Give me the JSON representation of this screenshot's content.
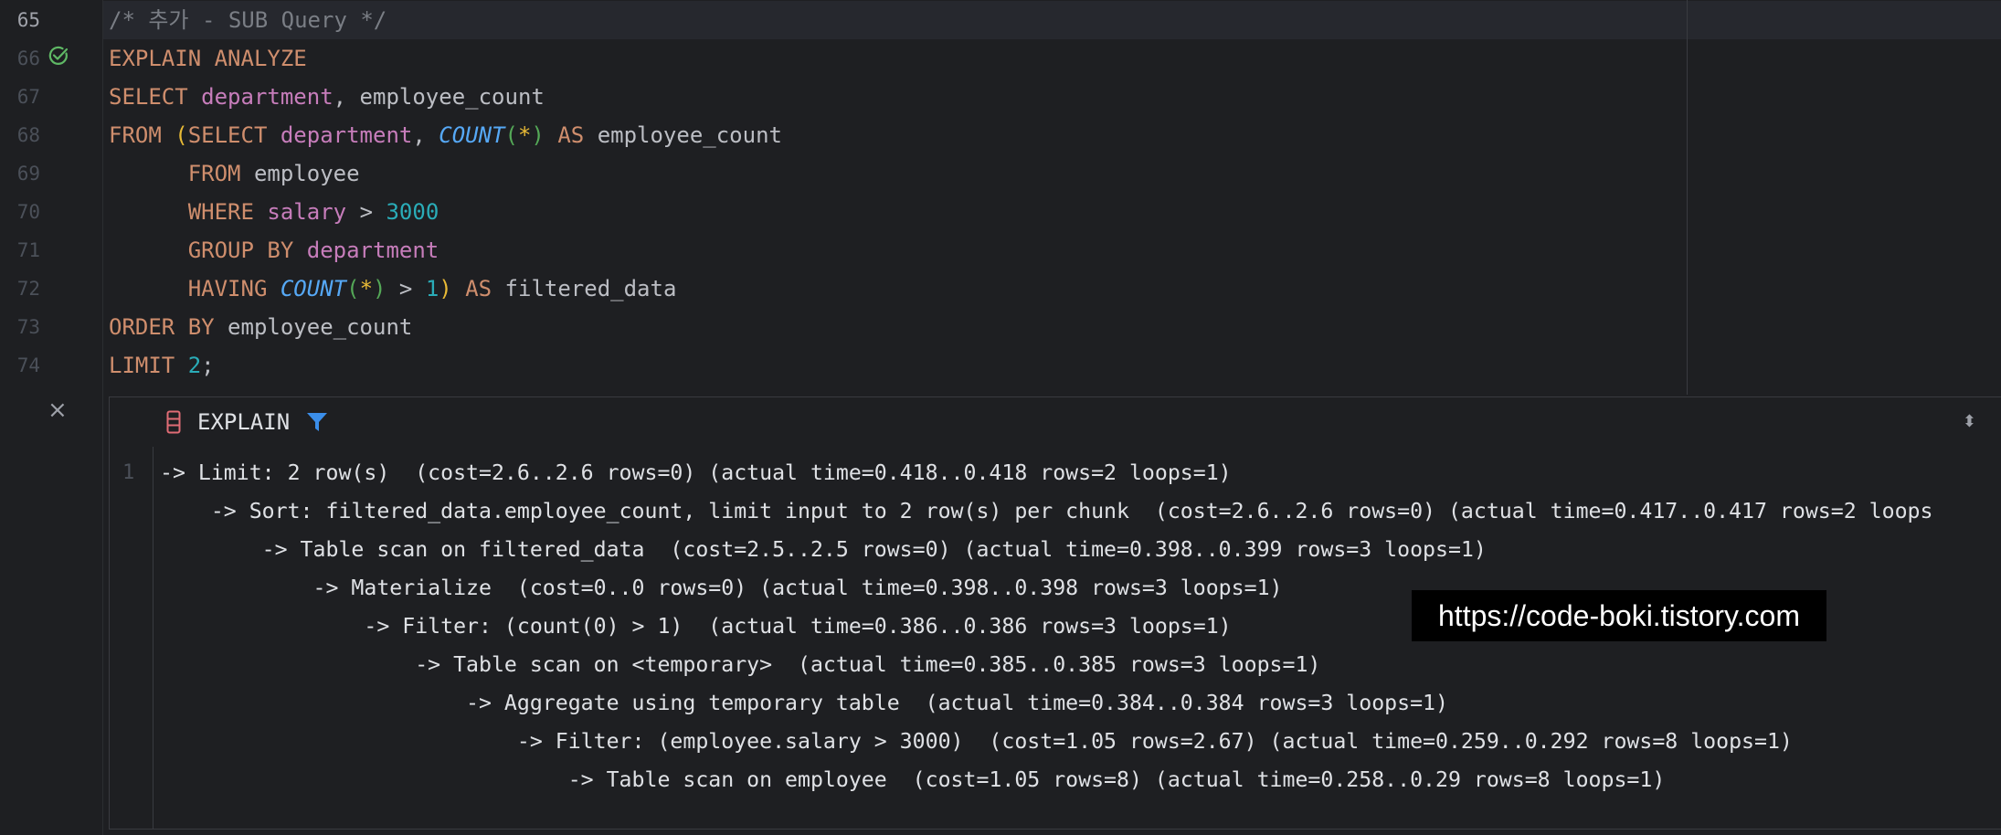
{
  "editor": {
    "lines": [
      {
        "num": "65",
        "current": true
      },
      {
        "num": "66"
      },
      {
        "num": "67"
      },
      {
        "num": "68"
      },
      {
        "num": "69"
      },
      {
        "num": "70"
      },
      {
        "num": "71"
      },
      {
        "num": "72"
      },
      {
        "num": "73"
      },
      {
        "num": "74"
      }
    ],
    "code": {
      "l65": "/* 추가 - SUB Query */",
      "l66_kw": "EXPLAIN ANALYZE",
      "l67_kw": "SELECT",
      "l67_fld": "department",
      "l67_rest": ", employee_count",
      "l68_kw": "FROM",
      "l68_p": "(",
      "l68_kw2": "SELECT",
      "l68_fld": "department",
      "l68_comma": ",",
      "l68_fn": "COUNT",
      "l68_po": "(",
      "l68_star": "*",
      "l68_pc": ")",
      "l68_as": "AS",
      "l68_alias": "employee_count",
      "l69_kw": "FROM",
      "l69_tbl": "employee",
      "l70_kw": "WHERE",
      "l70_fld": "salary",
      "l70_op": ">",
      "l70_num": "3000",
      "l71_kw": "GROUP BY",
      "l71_fld": "department",
      "l72_kw": "HAVING",
      "l72_fn": "COUNT",
      "l72_po": "(",
      "l72_star": "*",
      "l72_pc": ")",
      "l72_op": ">",
      "l72_num": "1",
      "l72_p": ")",
      "l72_as": "AS",
      "l72_alias": "filtered_data",
      "l73_kw": "ORDER BY",
      "l73_rest": "employee_count",
      "l74_kw": "LIMIT",
      "l74_num": "2",
      "l74_semi": ";"
    }
  },
  "explain": {
    "title": "EXPLAIN",
    "line_number": "1",
    "rows": [
      "-> Limit: 2 row(s)  (cost=2.6..2.6 rows=0) (actual time=0.418..0.418 rows=2 loops=1)",
      "    -> Sort: filtered_data.employee_count, limit input to 2 row(s) per chunk  (cost=2.6..2.6 rows=0) (actual time=0.417..0.417 rows=2 loops",
      "        -> Table scan on filtered_data  (cost=2.5..2.5 rows=0) (actual time=0.398..0.399 rows=3 loops=1)",
      "            -> Materialize  (cost=0..0 rows=0) (actual time=0.398..0.398 rows=3 loops=1)",
      "                -> Filter: (count(0) > 1)  (actual time=0.386..0.386 rows=3 loops=1)",
      "                    -> Table scan on <temporary>  (actual time=0.385..0.385 rows=3 loops=1)",
      "                        -> Aggregate using temporary table  (actual time=0.384..0.384 rows=3 loops=1)",
      "                            -> Filter: (employee.salary > 3000)  (cost=1.05 rows=2.67) (actual time=0.259..0.292 rows=8 loops=1)",
      "                                -> Table scan on employee  (cost=1.05 rows=8) (actual time=0.258..0.29 rows=8 loops=1)"
    ]
  },
  "watermark": "https://code-boki.tistory.com",
  "icons": {
    "run_status": "check-circle-icon",
    "close": "close-icon",
    "db": "database-icon",
    "filter": "filter-icon",
    "sort": "sort-toggle-icon"
  },
  "colors": {
    "keyword": "#cf8e6d",
    "field": "#c77dbb",
    "function": "#56a8f5",
    "number": "#2aacb8",
    "comment": "#7a7e85",
    "success": "#5fb865",
    "filter": "#3b8eea",
    "db_icon": "#e06c75"
  }
}
